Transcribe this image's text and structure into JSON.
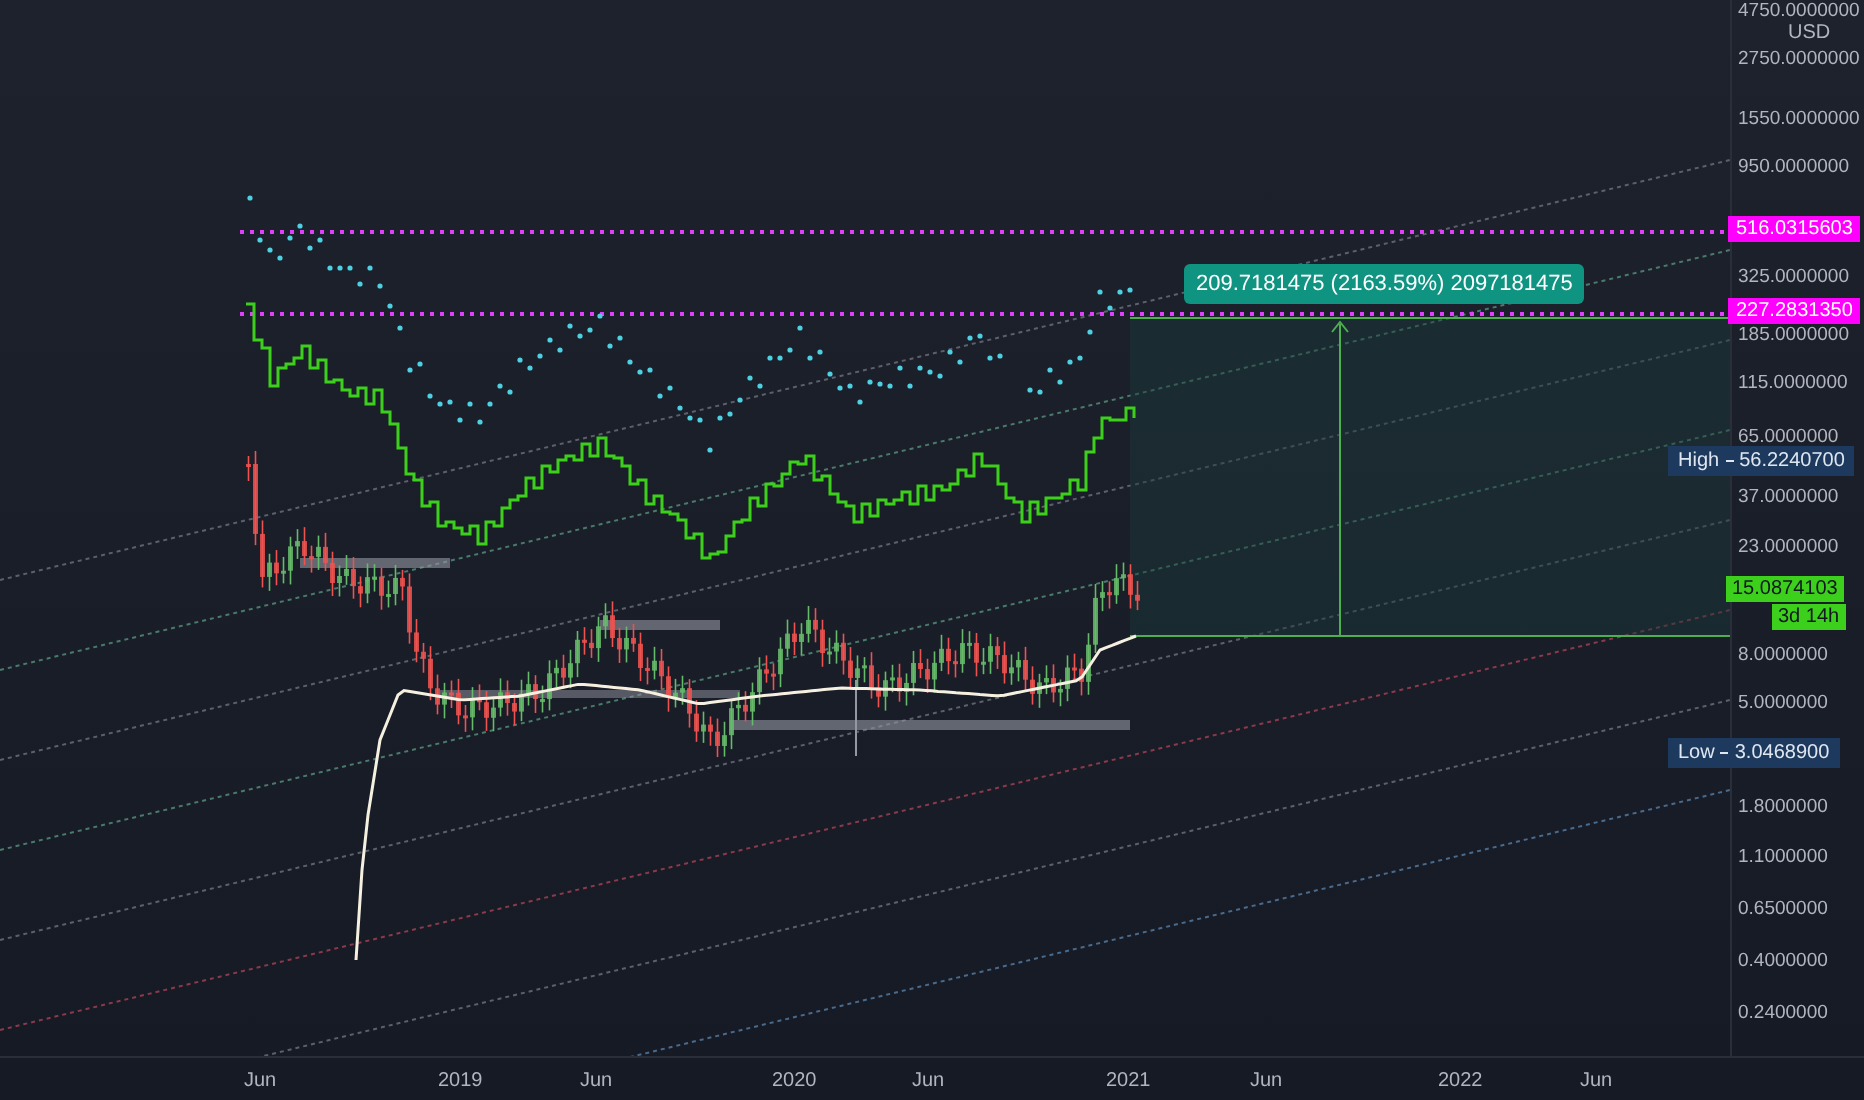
{
  "price_axis": {
    "currency": "USD",
    "ticks": [
      "4750.0000000",
      "2750.0000000",
      "1550.0000000",
      "950.0000000",
      "325.0000000",
      "185.0000000",
      "115.0000000",
      "65.0000000",
      "37.0000000",
      "23.0000000",
      "8.0000000",
      "5.0000000",
      "1.8000000",
      "1.1000000",
      "0.6500000",
      "0.4000000",
      "0.2400000"
    ]
  },
  "markers": [
    {
      "kind": "hline",
      "value": "516.0315603"
    },
    {
      "kind": "hline",
      "value": "227.2831350"
    },
    {
      "kind": "extreme",
      "label": "High",
      "value": "56.2240700"
    },
    {
      "kind": "last",
      "value": "15.0874103",
      "countdown": "3d 14h"
    },
    {
      "kind": "extreme",
      "label": "Low",
      "value": "3.0468900"
    }
  ],
  "measure": {
    "text": "209.7181475 (2163.59%) 2097181475"
  },
  "time_axis": [
    "Jun",
    "2019",
    "Jun",
    "2020",
    "Jun",
    "2021",
    "Jun",
    "2022",
    "Jun"
  ]
}
